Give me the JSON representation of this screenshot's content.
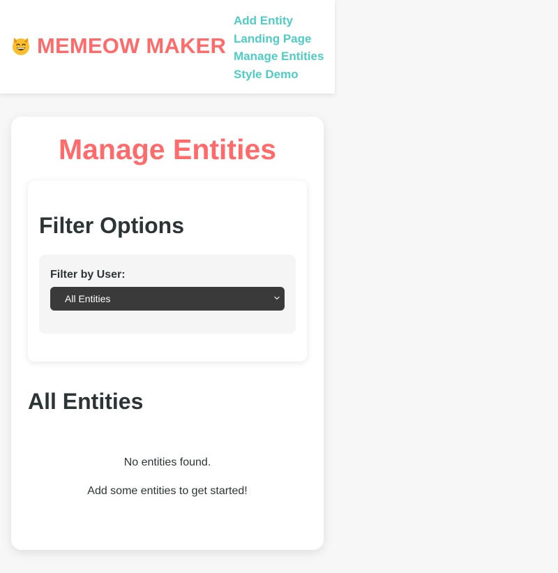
{
  "header": {
    "brand_icon": "cat-face-icon",
    "brand_title": "MEMEOW MAKER",
    "brand_color": "#ff6b6b",
    "nav_color": "#4ecdc4",
    "nav": [
      {
        "label": "Add Entity"
      },
      {
        "label": "Landing Page"
      },
      {
        "label": "Manage Entities"
      },
      {
        "label": "Style Demo"
      }
    ]
  },
  "main": {
    "title": "Manage Entities",
    "filter": {
      "title": "Filter Options",
      "label": "Filter by User:",
      "selected": "All Entities"
    },
    "entities": {
      "title": "All Entities",
      "empty_message": "No entities found.",
      "empty_hint": "Add some entities to get started!"
    }
  }
}
